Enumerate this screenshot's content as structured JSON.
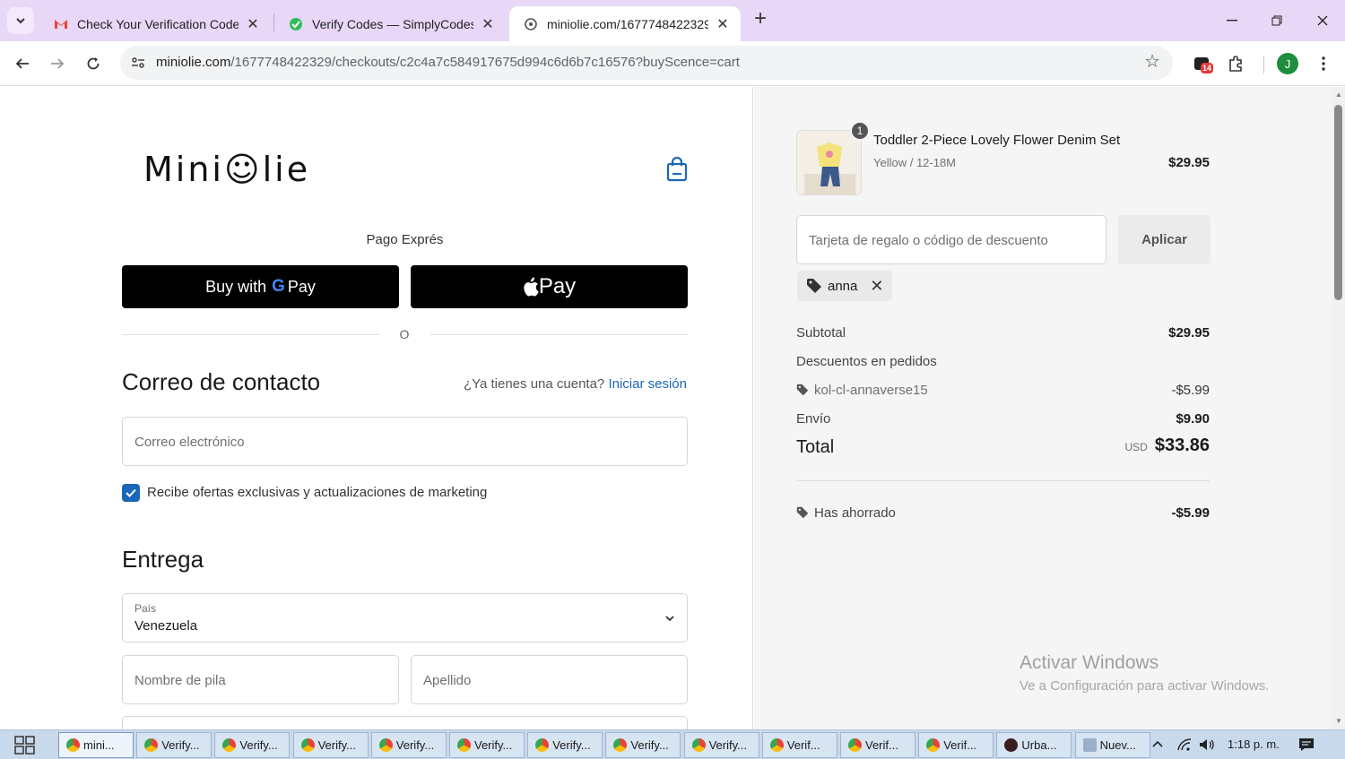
{
  "browser": {
    "tabs": [
      {
        "title": "Check Your Verification Code - ",
        "icon": "gmail-icon"
      },
      {
        "title": "Verify Codes — SimplyCodes",
        "icon": "simplycodes-icon"
      },
      {
        "title": "miniolie.com/1677748422329/c",
        "icon": "site-icon"
      }
    ],
    "url_host": "miniolie.com",
    "url_path": "/1677748422329/checkouts/c2c4a7c584917675d994c6d6b7c16576?buyScence=cart",
    "extension_badge": "14",
    "profile_initial": "J"
  },
  "checkout": {
    "logo": "Mini☺lie",
    "express_label": "Pago Exprés",
    "gpay_prefix": "Buy with",
    "gpay_g": "G",
    "gpay_suffix": "Pay",
    "applepay_label": " Pay",
    "or_label": "O",
    "contact_heading": "Correo de contacto",
    "account_question": "¿Ya tienes una cuenta?",
    "login_link": "Iniciar sesión",
    "email_placeholder": "Correo electrónico",
    "marketing_label": "Recibe ofertas exclusivas y actualizaciones de marketing",
    "marketing_checked": true,
    "delivery_heading": "Entrega",
    "country_label": "País",
    "country_value": "Venezuela",
    "first_name_placeholder": "Nombre de pila",
    "last_name_placeholder": "Apellido"
  },
  "summary": {
    "item": {
      "quantity": "1",
      "name": "Toddler 2-Piece Lovely Flower Denim Set",
      "variant": "Yellow / 12-18M",
      "price": "$29.95"
    },
    "discount_placeholder": "Tarjeta de regalo o código de descuento",
    "apply_label": "Aplicar",
    "applied_code": "anna",
    "subtotal_label": "Subtotal",
    "subtotal_value": "$29.95",
    "order_discounts_label": "Descuentos en pedidos",
    "discount_code": "kol-cl-annaverse15",
    "discount_value": "-$5.99",
    "shipping_label": "Envío",
    "shipping_value": "$9.90",
    "total_label": "Total",
    "total_currency": "USD",
    "total_value": "$33.86",
    "saved_label": "Has ahorrado",
    "saved_value": "-$5.99"
  },
  "watermark": {
    "title": "Activar Windows",
    "subtitle": "Ve a Configuración para activar Windows."
  },
  "taskbar": {
    "buttons": [
      "mini...",
      "Verify...",
      "Verify...",
      "Verify...",
      "Verify...",
      "Verify...",
      "Verify...",
      "Verify...",
      "Verify...",
      "Verif...",
      "Verif...",
      "Verif...",
      "Urba...",
      "Nuev..."
    ],
    "time": "1:18 p. m."
  },
  "colors": {
    "accent": "#1a66b8",
    "tabstrip": "#e8d7f7",
    "summary_bg": "#f5f5f5"
  }
}
